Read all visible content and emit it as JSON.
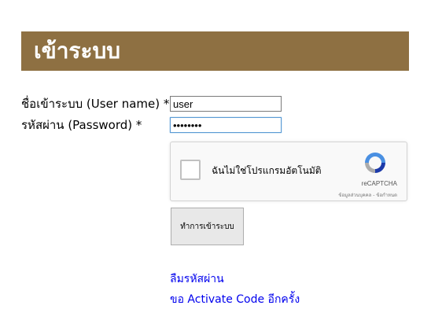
{
  "header": {
    "title": "เข้าระบบ"
  },
  "form": {
    "username_label": "ชื่อเข้าระบบ (User name) *",
    "username_value": "user",
    "password_label": "รหัสผ่าน (Password) *",
    "password_value": "••••••••"
  },
  "recaptcha": {
    "label": "ฉันไม่ใช่โปรแกรมอัตโนมัติ",
    "brand": "reCAPTCHA",
    "terms": "ข้อมูลส่วนบุคคล - ข้อกำหนด",
    "icon": "recaptcha-logo-icon"
  },
  "submit_label": "ทำการเข้าระบบ",
  "links": {
    "forgot_password": "ลืมรหัสผ่าน",
    "resend_activation": "ขอ Activate Code อีกครั้ง"
  },
  "colors": {
    "header_bg": "#8e7042",
    "link": "#0000ee"
  }
}
